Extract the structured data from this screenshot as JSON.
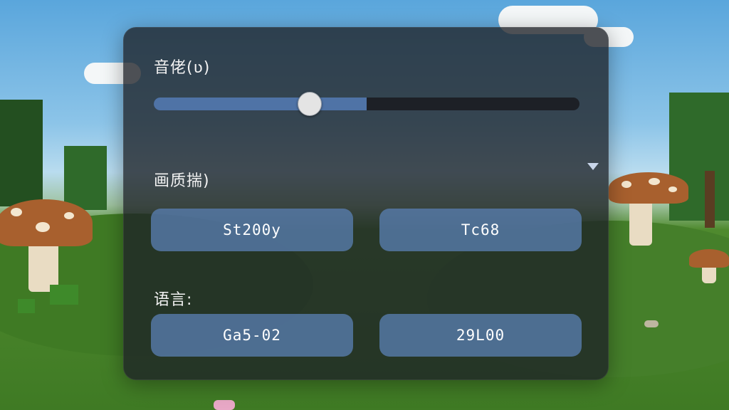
{
  "settings": {
    "volume": {
      "label": "音佬(ʋ)",
      "value_fraction": 0.5
    },
    "quality": {
      "label": "画质揣)",
      "options": [
        "St200y",
        "Tc68"
      ]
    },
    "language": {
      "label": "语言:",
      "options": [
        "Ga5-02",
        "29L00"
      ]
    }
  },
  "colors": {
    "panel_bg": "#1e2126",
    "button_bg": "#597eaf",
    "slider_fill": "#4f73a6",
    "slider_thumb": "#e4e4e4"
  },
  "icons": {
    "dropdown": "chevron-down-icon"
  }
}
